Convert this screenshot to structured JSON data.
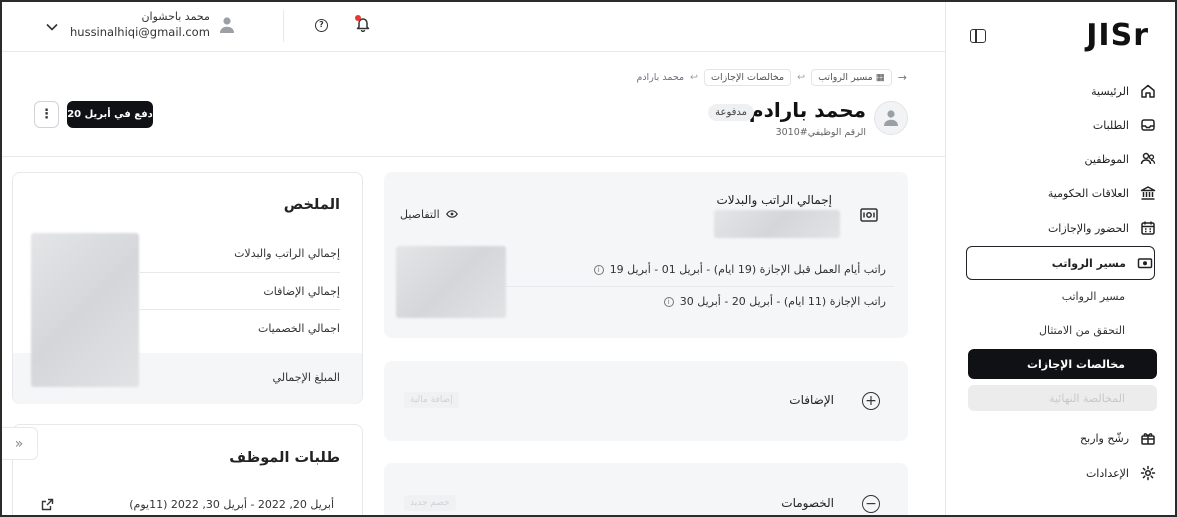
{
  "app": {
    "logo": "JISr"
  },
  "sidebar": {
    "items": [
      {
        "label": "الرئيسية",
        "icon": "home-icon"
      },
      {
        "label": "الطلبات",
        "icon": "inbox-icon"
      },
      {
        "label": "الموظفين",
        "icon": "users-icon"
      },
      {
        "label": "العلاقات الحكومية",
        "icon": "bank-icon"
      },
      {
        "label": "الحضور والإجازات",
        "icon": "calendar-icon"
      },
      {
        "label": "مسير الرواتب",
        "icon": "money-icon"
      },
      {
        "label": "رشّح واربح",
        "icon": "gift-icon"
      },
      {
        "label": "الإعدادات",
        "icon": "gear-icon"
      }
    ],
    "payroll_sub": {
      "item1": "مسير الرواتب",
      "item2": "التحقق من الامتثال",
      "item3": "مخالصات الإجازات",
      "item4": "المخالصة النهائية"
    }
  },
  "topbar": {
    "user_name": "محمد باحشوان",
    "user_email": "hussinalhiqi@gmail.com"
  },
  "header": {
    "breadcrumb": [
      "مسير الرواتب",
      "مخالصات الإجازات",
      "محمد بارادم"
    ],
    "employee_name": "محمد بارادم",
    "status": "مدفوعة",
    "employee_id": "الرقم الوظيفي#3010",
    "pay_button": "دفع في أبريل 20",
    "more": "⋮"
  },
  "salary_card": {
    "title": "إجمالي الراتب والبدلات",
    "details": "التفاصيل",
    "rows": [
      "راتب أيام العمل قبل الإجازة (19 ايام) - أبريل 01 - أبريل 19",
      "راتب الإجازة (11 ايام) - أبريل 20 - أبريل 30"
    ]
  },
  "additions_card": {
    "title": "الإضافات",
    "action": "إضافة مالية"
  },
  "deductions_card": {
    "title": "الخصومات",
    "action": "خصم جديد"
  },
  "summary": {
    "title": "الملخص",
    "rows": [
      "إجمالي الراتب والبدلات",
      "إجمالي الإضافات",
      "اجمالي الخصميات",
      "المبلغ الإجمالي"
    ]
  },
  "requests": {
    "title": "طلبات الموظف",
    "item": "أبريل 20, 2022 - أبريل 30, 2022 (11يوم)"
  },
  "edge": {
    "label": "»"
  }
}
